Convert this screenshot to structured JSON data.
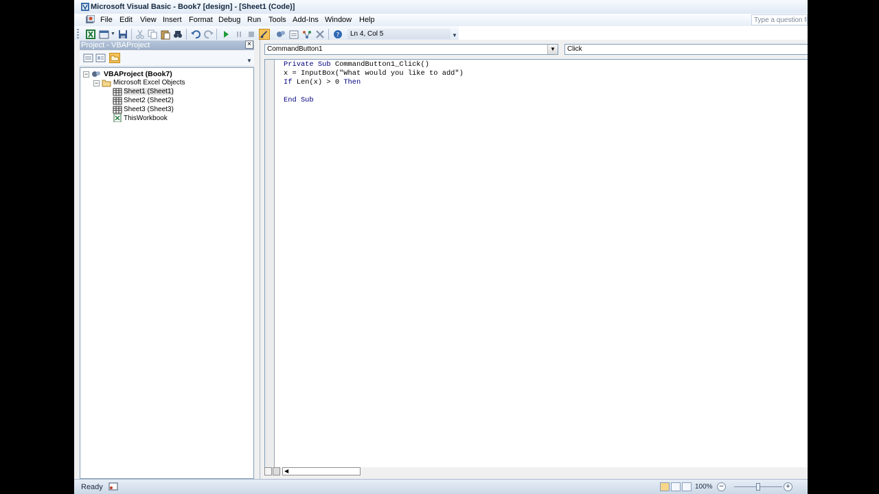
{
  "window": {
    "title": "Microsoft Visual Basic - Book7 [design] - [Sheet1 (Code)]"
  },
  "menu": {
    "items": [
      "File",
      "Edit",
      "View",
      "Insert",
      "Format",
      "Debug",
      "Run",
      "Tools",
      "Add-Ins",
      "Window",
      "Help"
    ],
    "help_placeholder": "Type a question for"
  },
  "toolbar": {
    "position": "Ln 4, Col 5",
    "buttons": [
      "excel-icon",
      "insert-userform-icon",
      "save-icon",
      "cut-icon",
      "copy-icon",
      "paste-icon",
      "find-icon",
      "undo-icon",
      "redo-icon",
      "run-icon",
      "break-icon",
      "reset-icon",
      "design-mode-icon",
      "project-explorer-icon",
      "properties-icon",
      "object-browser-icon",
      "toolbox-icon",
      "help-icon"
    ]
  },
  "project": {
    "title": "Project - VBAProject",
    "tree": {
      "root": "VBAProject (Book7)",
      "folder": "Microsoft Excel Objects",
      "items": [
        "Sheet1 (Sheet1)",
        "Sheet2 (Sheet2)",
        "Sheet3 (Sheet3)",
        "ThisWorkbook"
      ],
      "selected": "Sheet1 (Sheet1)"
    }
  },
  "code": {
    "object": "CommandButton1",
    "procedure": "Click",
    "lines": [
      {
        "kw": "Private Sub",
        "rest": " CommandButton1_Click()"
      },
      {
        "kw": "",
        "rest": "x = InputBox(\"What would you like to add\")"
      },
      {
        "kw": "If",
        "rest": " Len(x) > 0 ",
        "kw2": "Then"
      },
      {
        "kw": "",
        "rest": ""
      },
      {
        "kw": "End Sub",
        "rest": ""
      }
    ]
  },
  "status": {
    "text": "Ready",
    "zoom": "100%",
    "zoom_level": 100
  },
  "colors": {
    "keyword": "#00007f",
    "selection": "#e6e6e6"
  }
}
